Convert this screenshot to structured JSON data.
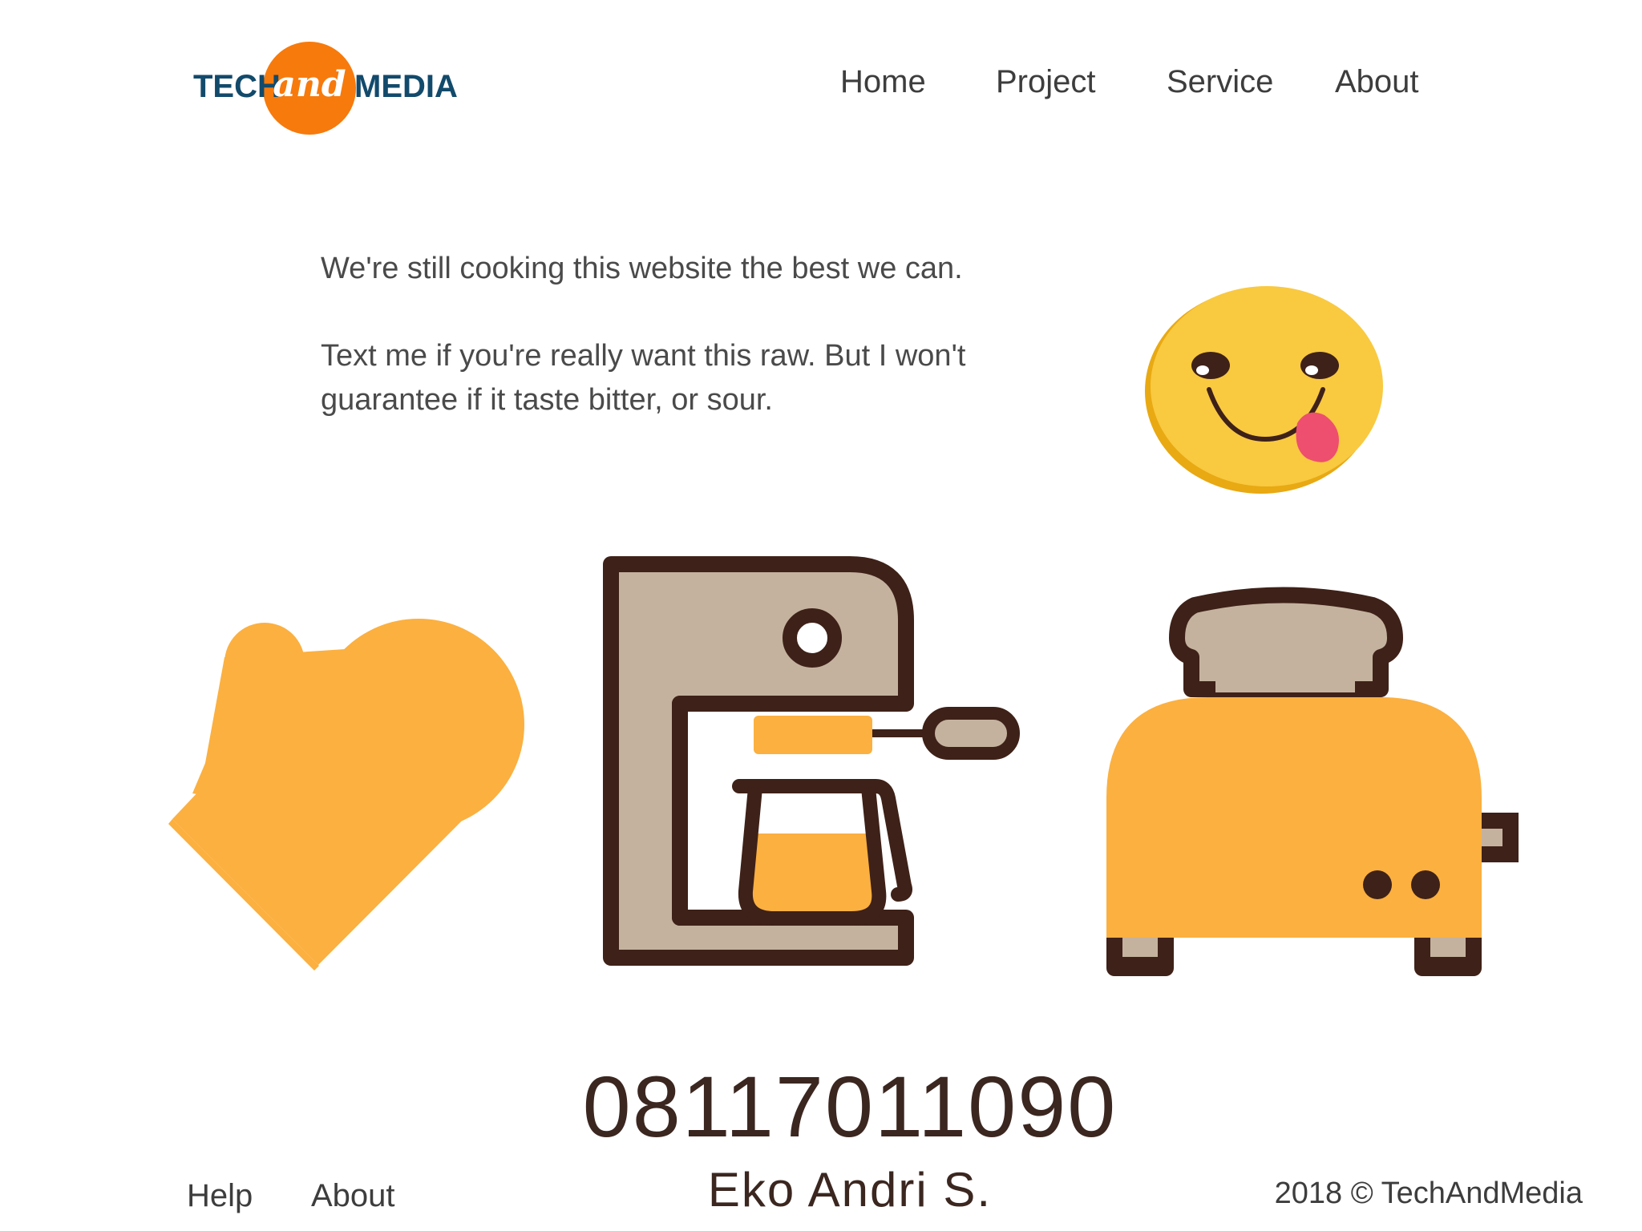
{
  "logo": {
    "tech": "TECH",
    "and": "and",
    "media": "MEDIA"
  },
  "nav": {
    "items": [
      "Home",
      "Project",
      "Service",
      "About"
    ]
  },
  "message": {
    "line1": "We're still cooking this website the best we can.",
    "line2": "Text me if you're really want this raw. But I won't guarantee if it taste bitter, or sour."
  },
  "contact": {
    "phone": "08117011090",
    "name": "Eko Andri S."
  },
  "footer": {
    "links": [
      "Help",
      "About"
    ],
    "copyright": "2018 © TechAndMedia"
  },
  "colors": {
    "accent": "#f77a0c",
    "brand": "#124a6b",
    "mustard": "#fbb040",
    "brown": "#3e2118",
    "beige": "#c4b29e",
    "emoji": "#f9c940"
  },
  "icons": [
    "emoji-tongue-icon",
    "oven-mitt-icon",
    "coffee-maker-icon",
    "toaster-icon"
  ]
}
